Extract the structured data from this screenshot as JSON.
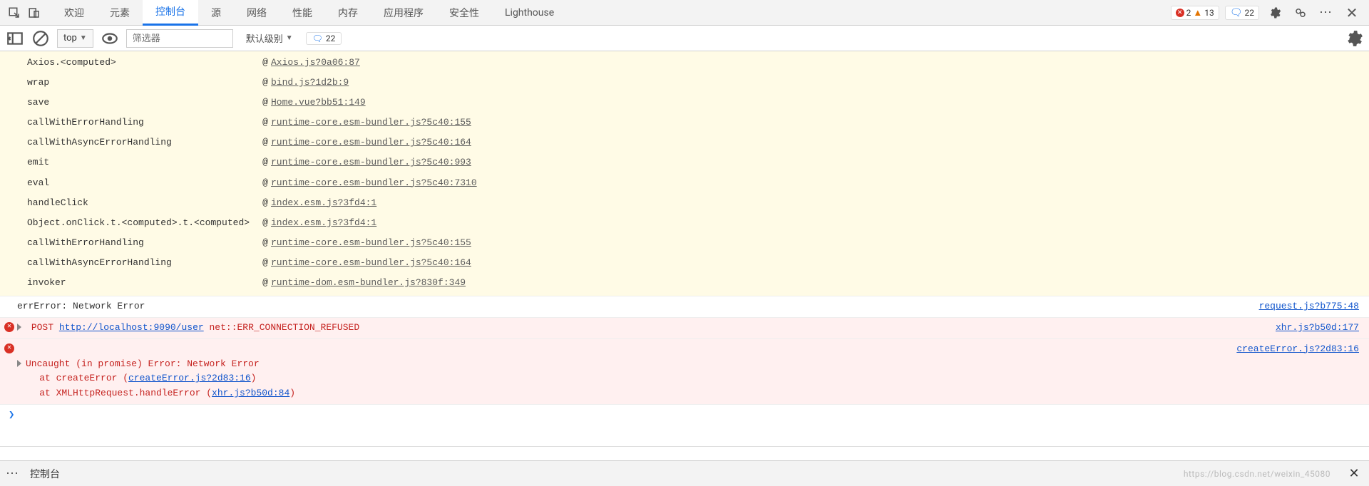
{
  "tabs": {
    "items": [
      {
        "label": "欢迎"
      },
      {
        "label": "元素"
      },
      {
        "label": "控制台"
      },
      {
        "label": "源"
      },
      {
        "label": "网络"
      },
      {
        "label": "性能"
      },
      {
        "label": "内存"
      },
      {
        "label": "应用程序"
      },
      {
        "label": "安全性"
      },
      {
        "label": "Lighthouse"
      }
    ],
    "active_index": 2
  },
  "counters": {
    "errors": "2",
    "warnings": "13",
    "messages": "22"
  },
  "toolbar": {
    "context": "top",
    "filter_placeholder": "筛选器",
    "level_label": "默认级别",
    "issue_count": "22"
  },
  "stack": [
    {
      "fn": "Axios.<computed>",
      "src": "Axios.js?0a06:87"
    },
    {
      "fn": "wrap",
      "src": "bind.js?1d2b:9"
    },
    {
      "fn": "save",
      "src": "Home.vue?bb51:149"
    },
    {
      "fn": "callWithErrorHandling",
      "src": "runtime-core.esm-bundler.js?5c40:155"
    },
    {
      "fn": "callWithAsyncErrorHandling",
      "src": "runtime-core.esm-bundler.js?5c40:164"
    },
    {
      "fn": "emit",
      "src": "runtime-core.esm-bundler.js?5c40:993"
    },
    {
      "fn": "eval",
      "src": "runtime-core.esm-bundler.js?5c40:7310"
    },
    {
      "fn": "handleClick",
      "src": "index.esm.js?3fd4:1"
    },
    {
      "fn": "Object.onClick.t.<computed>.t.<computed>",
      "src": "index.esm.js?3fd4:1"
    },
    {
      "fn": "callWithErrorHandling",
      "src": "runtime-core.esm-bundler.js?5c40:155"
    },
    {
      "fn": "callWithAsyncErrorHandling",
      "src": "runtime-core.esm-bundler.js?5c40:164"
    },
    {
      "fn": "invoker",
      "src": "runtime-dom.esm-bundler.js?830f:349"
    }
  ],
  "logs": {
    "plain": {
      "text": "errError: Network Error",
      "src": "request.js?b775:48"
    },
    "err1": {
      "method": "POST",
      "url": "http://localhost:9090/user",
      "extra": "net::ERR_CONNECTION_REFUSED",
      "src": "xhr.js?b50d:177"
    },
    "err2": {
      "head": "Uncaught (in promise) Error: Network Error",
      "l1_pre": "    at createError (",
      "l1_link": "createError.js?2d83:16",
      "l1_post": ")",
      "l2_pre": "    at XMLHttpRequest.handleError (",
      "l2_link": "xhr.js?b50d:84",
      "l2_post": ")",
      "src": "createError.js?2d83:16"
    }
  },
  "drawer": {
    "tab": "控制台",
    "watermark": "https://blog.csdn.net/weixin_45080"
  },
  "at_symbol": "@",
  "prompt": "❯"
}
